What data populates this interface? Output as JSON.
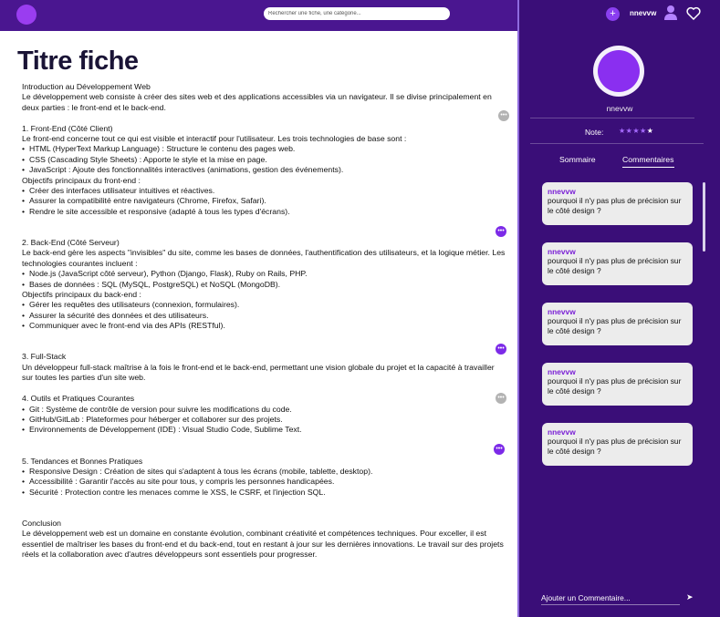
{
  "header": {
    "search_placeholder": "Rechercher une fiche, une catégorie...",
    "add_icon": "+",
    "username": "nnevvw",
    "brand_color": "#4a1690"
  },
  "main": {
    "title": "Titre fiche",
    "sections": [
      {
        "lines": [
          "Introduction au Développement Web",
          "Le développement web consiste à créer des sites web et des applications accessibles via un navigateur. Il se divise principalement en deux parties : le front-end et le back-end."
        ]
      },
      {
        "lines": [
          "1. Front-End (Côté Client)",
          "Le front-end concerne tout ce qui est visible et interactif pour l'utilisateur. Les trois technologies de base sont :"
        ],
        "bullets1": [
          "HTML (HyperText Markup Language) : Structure le contenu des pages web.",
          "CSS (Cascading Style Sheets) : Apporte le style et la mise en page.",
          "JavaScript : Ajoute des fonctionnalités interactives (animations, gestion des événements)."
        ],
        "sub": "Objectifs principaux du front-end :",
        "bullets2": [
          "Créer des interfaces utilisateur intuitives et réactives.",
          "Assurer la compatibilité entre navigateurs (Chrome, Firefox, Safari).",
          "Rendre le site accessible et responsive (adapté à tous les types d'écrans)."
        ]
      },
      {
        "lines": [
          "2. Back-End (Côté Serveur)",
          "Le back-end gère les aspects \"invisibles\" du site, comme les bases de données, l'authentification des utilisateurs, et la logique métier. Les technologies courantes incluent :"
        ],
        "bullets1": [
          "Node.js (JavaScript côté serveur), Python (Django, Flask), Ruby on Rails, PHP.",
          "Bases de données : SQL (MySQL, PostgreSQL) et NoSQL (MongoDB)."
        ],
        "sub": "Objectifs principaux du back-end :",
        "bullets2": [
          "Gérer les requêtes des utilisateurs (connexion, formulaires).",
          "Assurer la sécurité des données et des utilisateurs.",
          "Communiquer avec le front-end via des APIs (RESTful)."
        ]
      },
      {
        "lines": [
          "3. Full-Stack",
          "Un développeur full-stack maîtrise à la fois le front-end et le back-end, permettant une vision globale du projet et la capacité à travailler sur toutes les parties d'un site web."
        ]
      },
      {
        "lines": [
          "4. Outils et Pratiques Courantes"
        ],
        "bullets1": [
          "Git : Système de contrôle de version pour suivre les modifications du code.",
          "GitHub/GitLab : Plateformes pour héberger et collaborer sur des projets.",
          "Environnements de Développement (IDE) : Visual Studio Code, Sublime Text."
        ]
      },
      {
        "lines": [
          "5. Tendances et Bonnes Pratiques"
        ],
        "bullets1": [
          "Responsive Design : Création de sites qui s'adaptent à tous les écrans (mobile, tablette, desktop).",
          "Accessibilité : Garantir l'accès au site pour tous, y compris les personnes handicapées.",
          "Sécurité : Protection contre les menaces comme le XSS, le CSRF, et l'injection SQL."
        ]
      },
      {
        "lines": [
          "Conclusion",
          "Le développement web est un domaine en constante évolution, combinant créativité et compétences techniques. Pour exceller, il est essentiel de maîtriser les bases du front-end et du back-end, tout en restant à jour sur les dernières innovations. Le travail sur des projets réels et la collaboration avec d'autres développeurs sont essentiels pour progresser."
        ]
      }
    ],
    "comment_markers": [
      "grey",
      "purple",
      "purple",
      "grey",
      "purple"
    ]
  },
  "panel": {
    "profile_name": "nnevvw",
    "note_label": "Note:",
    "rating": 4,
    "rating_max": 5,
    "tabs": [
      "Sommaire",
      "Commentaires"
    ],
    "active_tab": "Commentaires",
    "comments": [
      {
        "author": "nnevvw",
        "text": "pourquoi il n'y pas plus de précision sur le côté design ?"
      },
      {
        "author": "nnevvw",
        "text": "pourquoi il n'y pas plus de précision sur le côté design ?"
      },
      {
        "author": "nnevvw",
        "text": "pourquoi il n'y pas plus de précision sur le côté design ?"
      },
      {
        "author": "nnevvw",
        "text": "pourquoi il n'y pas plus de précision sur le côté design ?"
      },
      {
        "author": "nnevvw",
        "text": "pourquoi il n'y pas plus de précision sur le côté design ?"
      }
    ],
    "add_comment_placeholder": "Ajouter un Commentaire...",
    "send_icon": "➤",
    "accent_color": "#3a0e78"
  }
}
